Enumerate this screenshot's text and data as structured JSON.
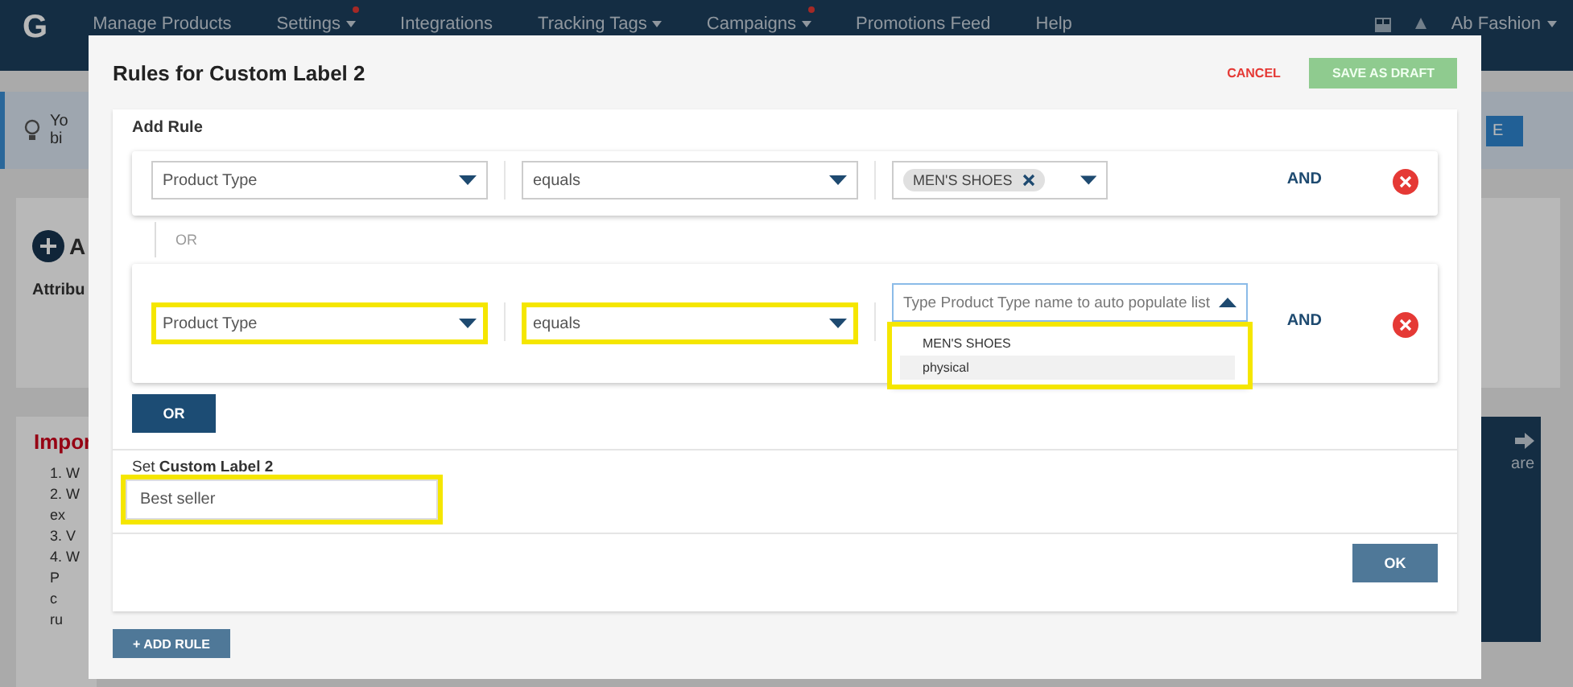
{
  "navbar": {
    "logo": "G",
    "items": [
      {
        "label": "Manage Products",
        "badge": false,
        "caret": false
      },
      {
        "label": "Settings",
        "badge": true,
        "caret": true
      },
      {
        "label": "Integrations",
        "badge": false,
        "caret": false
      },
      {
        "label": "Tracking Tags",
        "badge": false,
        "caret": true
      },
      {
        "label": "Campaigns",
        "badge": true,
        "caret": true
      },
      {
        "label": "Promotions Feed",
        "badge": false,
        "caret": false
      },
      {
        "label": "Help",
        "badge": false,
        "caret": false
      }
    ],
    "account": "Ab Fashion"
  },
  "background": {
    "alert_lines": [
      "Yo",
      "bi"
    ],
    "alert_button": "E",
    "card_title": "A",
    "card_column": "Attribu",
    "notes_title": "Impor",
    "notes_lines": [
      "1. W",
      "2. W",
      "ex",
      "3. V",
      "4. W",
      "P",
      "c",
      "ru"
    ],
    "panel_text": "are"
  },
  "modal": {
    "title": "Rules for Custom Label 2",
    "cancel": "CANCEL",
    "save": "SAVE AS DRAFT",
    "section_title": "Add Rule",
    "rules": [
      {
        "attribute": {
          "value": "Product Type",
          "highlighted": false
        },
        "operator": {
          "value": "equals",
          "highlighted": false
        },
        "values": {
          "kind": "tags",
          "tags": [
            "MEN'S SHOES"
          ],
          "highlighted": false
        },
        "conjunction": "AND"
      },
      {
        "attribute": {
          "value": "Product Type",
          "highlighted": true
        },
        "operator": {
          "value": "equals",
          "highlighted": true
        },
        "values": {
          "kind": "search",
          "placeholder": "Type Product Type name to auto populate list",
          "highlighted": true,
          "options": [
            {
              "label": "MEN'S SHOES",
              "selected": false
            },
            {
              "label": "physical",
              "selected": true
            }
          ]
        },
        "conjunction": "AND"
      }
    ],
    "separator": "OR",
    "or_button": "OR",
    "set_label": "Set **Custom Label 2**",
    "label_value": "Best seller",
    "label_highlighted": true,
    "ok": "OK",
    "add_rule": "+ ADD RULE"
  }
}
